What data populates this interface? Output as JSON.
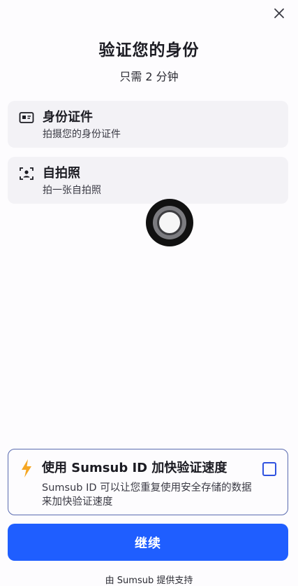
{
  "close_label": "×",
  "header": {
    "title": "验证您的身份",
    "subtitle": "只需 2 分钟"
  },
  "steps": [
    {
      "icon": "id-card-icon",
      "title": "身份证件",
      "description": "拍摄您的身份证件"
    },
    {
      "icon": "selfie-face-scan-icon",
      "title": "自拍照",
      "description": "拍一张自拍照"
    }
  ],
  "promo": {
    "icon": "lightning-bolt-icon",
    "title": "使用 Sumsub ID 加快验证速度",
    "description": "Sumsub ID 可以让您重复使用安全存储的数据来加快验证速度",
    "checked": false
  },
  "continue_label": "继续",
  "footer": "由 Sumsub 提供支持",
  "colors": {
    "primary": "#1f5eff",
    "bolt": "#f5a623",
    "card_bg": "#f3f2f6",
    "promo_border": "#5a6bb0"
  }
}
